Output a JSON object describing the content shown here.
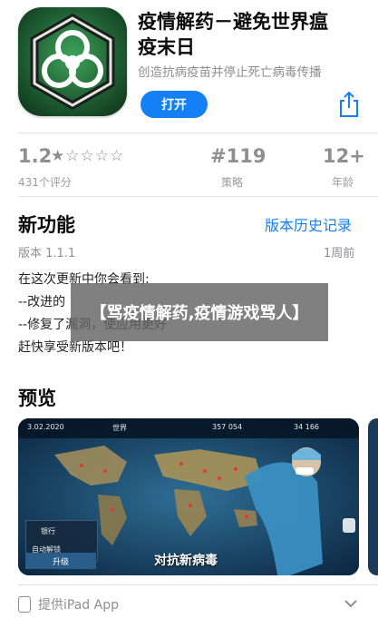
{
  "app": {
    "title_line1": "疫情解药－避免世界瘟",
    "title_line2": "疫末日",
    "subtitle": "创造抗病疫苗并停止死亡病毒传播",
    "get_label": "打开"
  },
  "stats": {
    "rating": "1.2",
    "stars": "★☆☆☆☆",
    "ratings_count": "431个评分",
    "rank": "#119",
    "rank_caption": "策略",
    "age": "12+",
    "age_caption": "年龄"
  },
  "whats_new": {
    "title": "新功能",
    "history_link": "版本历史记录",
    "version": "版本 1.1.1",
    "time_ago": "1周前",
    "notes": [
      "在这次更新中你会看到:",
      "--改进的",
      "--修复了漏洞，使应用更好",
      "赶快享受新版本吧！"
    ],
    "overlay_text": "【骂疫情解药,疫情游戏骂人】"
  },
  "preview": {
    "title": "预览",
    "hud_date": "3.02.2020",
    "hud_world": "世界",
    "hud_count_1": "357 054",
    "hud_count_2": "34 166",
    "caption": "对抗新病毒",
    "upgrade_label": "升级",
    "side_label_1": "银行",
    "side_label_2": "自动解锁"
  },
  "footer": {
    "ipad_label": "提供iPad App"
  },
  "colors": {
    "accent": "#1580f5",
    "secondary_text": "#8e8e93"
  }
}
